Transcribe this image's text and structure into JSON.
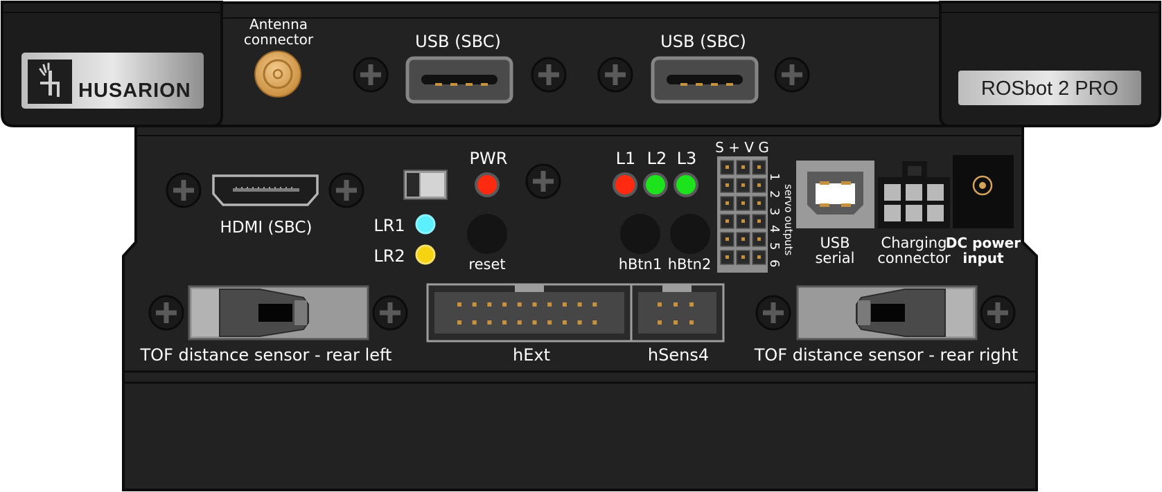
{
  "brand": {
    "logo_text": "HUSARION",
    "model_badge": "ROSbot 2 PRO"
  },
  "labels": {
    "antenna": [
      "Antenna",
      "connector"
    ],
    "usb_sbc_1": "USB (SBC)",
    "usb_sbc_2": "USB (SBC)",
    "hdmi": "HDMI (SBC)",
    "pwr": "PWR",
    "lr1": "LR1",
    "lr2": "LR2",
    "reset": "reset",
    "l1": "L1",
    "l2": "L2",
    "l3": "L3",
    "hbtn1": "hBtn1",
    "hbtn2": "hBtn2",
    "servo_header": "S + V G",
    "servo_rows": [
      "1",
      "2",
      "3",
      "4",
      "5",
      "6"
    ],
    "servo_outputs": "servo outputs",
    "usb_serial": [
      "USB",
      "serial"
    ],
    "charging": [
      "Charging",
      "connector"
    ],
    "dc_power": [
      "DC power",
      "input"
    ],
    "tof_left": "TOF distance sensor - rear left",
    "tof_right": "TOF distance sensor - rear right",
    "hext": "hExt",
    "hsens4": "hSens4"
  },
  "colors": {
    "body_dark": "#1e1e1e",
    "panel": "#2a2a2a",
    "pwr_led": "#ff2a10",
    "lr1_led": "#5cf0ff",
    "lr2_led": "#f5d311",
    "l1_led": "#ff2a10",
    "l2_led": "#1de31d",
    "l3_led": "#1de31d",
    "antenna_gold": "#d9a95a",
    "connector_gray": "#9a9a9a"
  },
  "icons": [
    "screw-icon",
    "husarion-logo-icon",
    "antenna-sma-icon"
  ]
}
